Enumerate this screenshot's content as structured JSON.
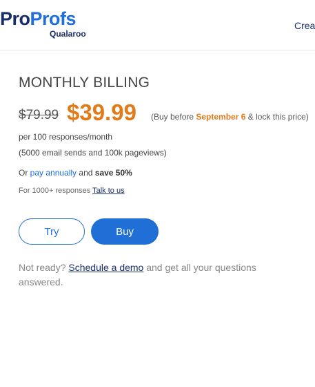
{
  "header": {
    "logo_pro": "Pro",
    "logo_profs": "Profs",
    "logo_sub": "Qualaroo",
    "nav_cut": "Crea"
  },
  "plan": {
    "title": "MONTHLY BILLING",
    "old_price": "$79.99",
    "new_price": "$39.99",
    "deal_pre": "(Buy before ",
    "deal_date": "September 6",
    "deal_post": " & lock this price)",
    "per": "per 100 responses/month",
    "includes": "(5000 email sends and 100k pageviews)",
    "annual_pre": "Or ",
    "annual_link": "pay annually",
    "annual_mid": " and ",
    "annual_save": "save 50%",
    "large_pre": "For 1000+ responses ",
    "large_link": "Talk to us"
  },
  "buttons": {
    "try": "Try",
    "buy": "Buy"
  },
  "footer": {
    "pre": "Not ready? ",
    "link": "Schedule a demo",
    "post": " and get all your questions answered."
  },
  "colors": {
    "accent": "#1f6fd6",
    "price": "#e07b1a",
    "navy": "#1a2d6b"
  }
}
